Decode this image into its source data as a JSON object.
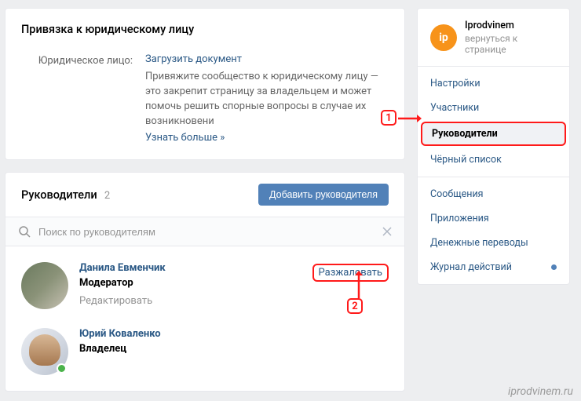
{
  "legal": {
    "title": "Привязка к юридическому лицу",
    "label": "Юридическое лицо:",
    "upload": "Загрузить документ",
    "description": "Привяжите сообщество к юридическому лицу — это закрепит страницу за владельцем и может помочь решить спорные вопросы в случае их возникновени",
    "more": "Узнать больше »"
  },
  "leaders": {
    "title": "Руководители",
    "count": "2",
    "add_button": "Добавить руководителя",
    "search_placeholder": "Поиск по руководителям",
    "members": [
      {
        "name": "Данила Евменчик",
        "role": "Модератор",
        "edit": "Редактировать",
        "action": "Разжаловать"
      },
      {
        "name": "Юрий Коваленко",
        "role": "Владелец"
      }
    ]
  },
  "profile": {
    "avatar_text": "ip",
    "name": "Iprodvinem",
    "back": "вернуться к странице"
  },
  "menu": {
    "items": [
      "Настройки",
      "Участники",
      "Руководители",
      "Чёрный список",
      "Сообщения",
      "Приложения",
      "Денежные переводы",
      "Журнал действий"
    ]
  },
  "annotations": {
    "num1": "1",
    "num2": "2"
  },
  "watermark": "iprodvinem.ru"
}
